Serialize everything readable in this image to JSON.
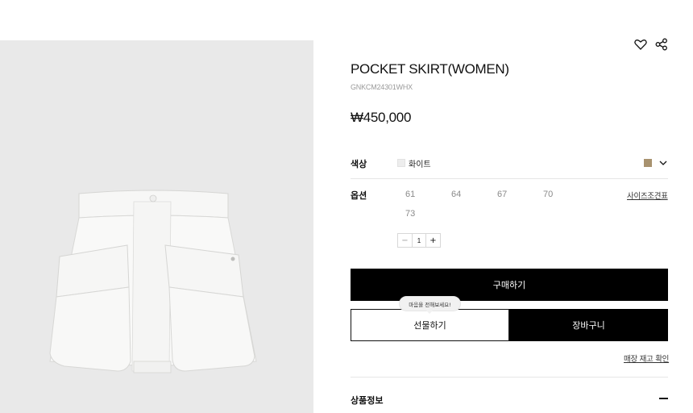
{
  "product": {
    "title": "POCKET SKIRT(WOMEN)",
    "code": "GNKCM24301WHX",
    "price": "₩450,000",
    "image_alt": "white pocket skirt"
  },
  "icons": {
    "wishlist": "heart-icon",
    "share": "share-icon",
    "dropdown": "chevron-down-icon"
  },
  "color": {
    "label": "색상",
    "selected_name": "화이트",
    "selected_hex": "#ededed",
    "alt_hex": "#a8926f"
  },
  "options": {
    "label": "옵션",
    "sizes": [
      "61",
      "64",
      "67",
      "70",
      "73"
    ],
    "size_guide": "사이즈조견표"
  },
  "quantity": {
    "minus": "−",
    "value": "1",
    "plus": "+"
  },
  "actions": {
    "buy": "구매하기",
    "gift": "선물하기",
    "cart": "장바구니",
    "gift_tooltip": "마음을 전해보세요!",
    "store_stock": "매장 재고 확인"
  },
  "info": {
    "title": "상품정보",
    "toggle": "−"
  }
}
